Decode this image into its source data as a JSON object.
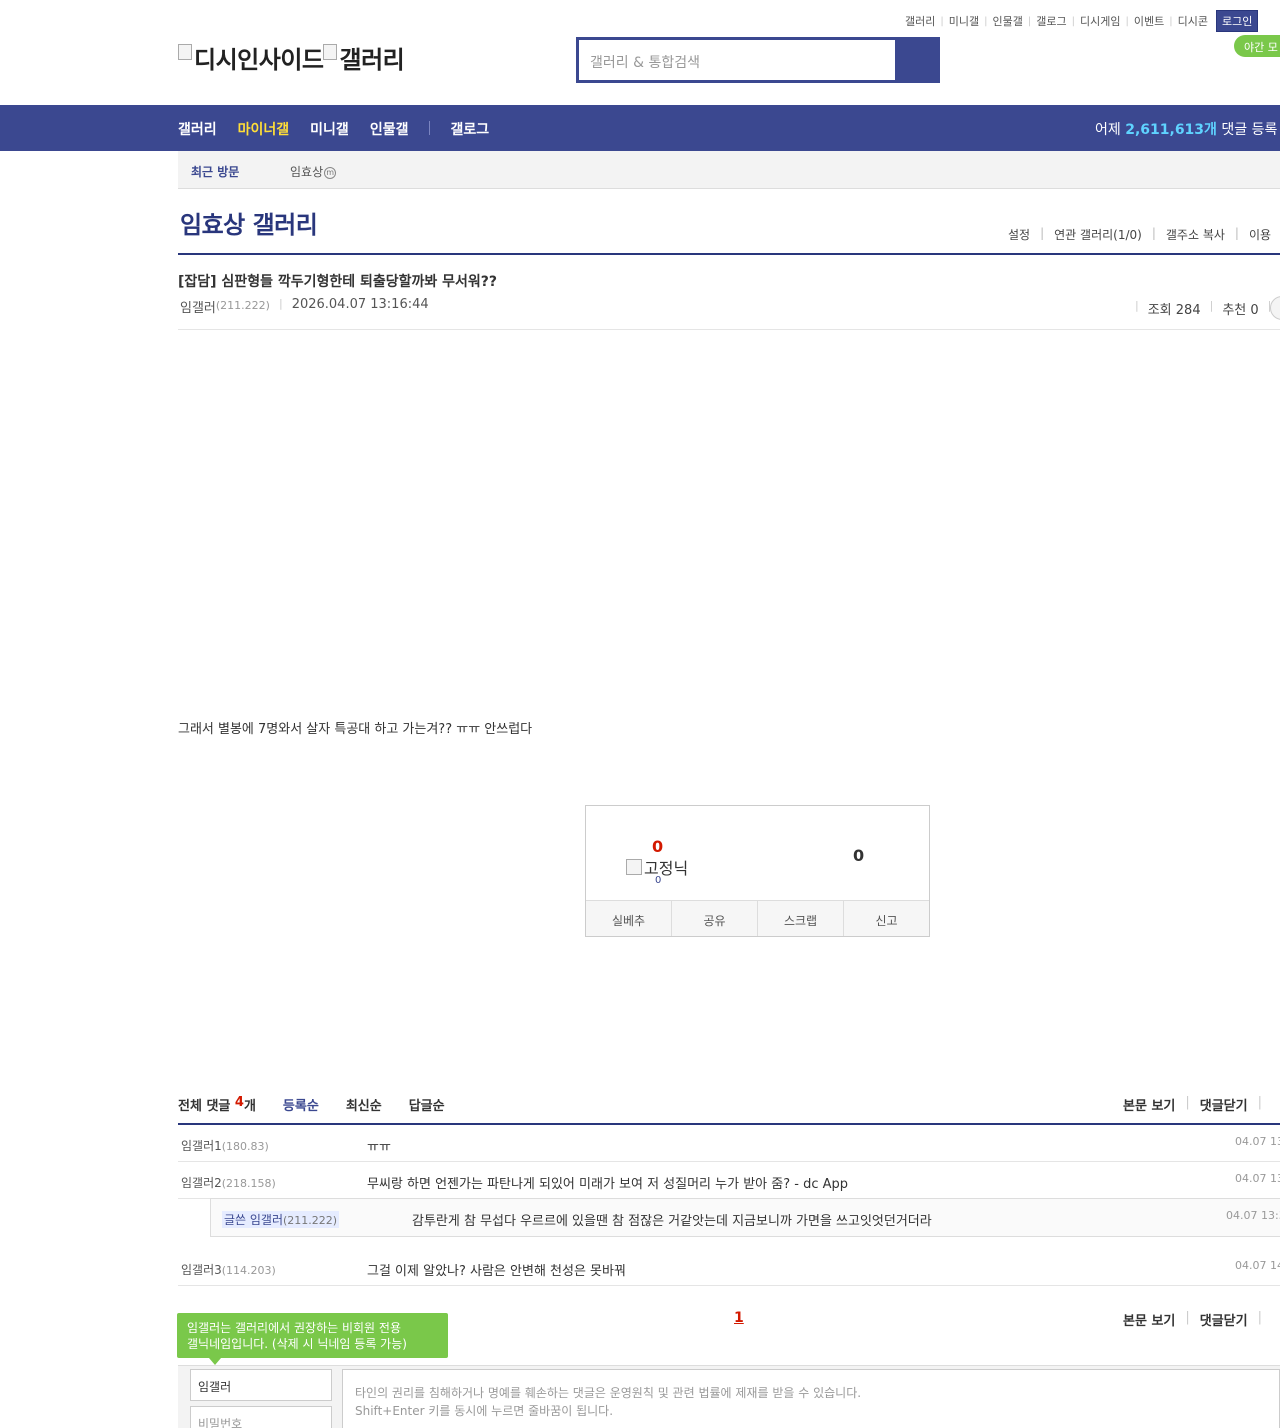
{
  "top_links": [
    "갤러리",
    "미니갤",
    "인물갤",
    "갤로그",
    "디시게임",
    "이벤트",
    "디시콘"
  ],
  "login_label": "로그인",
  "night_mode_label": "야간 모",
  "logo": {
    "left": "디시인사이드",
    "right": "갤러리"
  },
  "search": {
    "placeholder": "갤러리 & 통합검색"
  },
  "nav": {
    "items": [
      "갤러리",
      "마이너갤",
      "미니갤",
      "인물갤",
      "갤로그"
    ],
    "active": "마이너갤",
    "stat_prefix": "어제",
    "stat_value": "2,611,613개",
    "stat_suffix": "댓글 등록"
  },
  "recent": {
    "title": "최근 방문",
    "item": "임효상",
    "item_badge": "m"
  },
  "gallery": {
    "title": "임효상 갤러리",
    "menu": [
      "설정",
      "연관 갤러리(1/0)",
      "갤주소 복사",
      "이용"
    ]
  },
  "post": {
    "title": "[잡담] 심판형들 깍두기형한테 퇴출당할까봐 무서워??",
    "author": "임갤러",
    "author_ip": "(211.222)",
    "date": "2026.04.07 13:16:44",
    "views_label": "조회 284",
    "recommend_label": "추천 0",
    "body": "그래서 별봉에 7명와서 살자 특공대 하고 가는겨?? ㅠㅠ 안쓰럽다"
  },
  "recommend_box": {
    "up_count": "0",
    "fixnick_label": "고정닉",
    "fixnick_count": "0",
    "down_count": "0",
    "buttons": [
      "실베추",
      "공유",
      "스크랩",
      "신고"
    ]
  },
  "comments_header": {
    "total_prefix": "전체 댓글",
    "total_count": "4",
    "total_suffix": "개",
    "sorts": [
      "등록순",
      "최신순",
      "답글순"
    ],
    "right": [
      "본문 보기",
      "댓글닫기"
    ]
  },
  "comments": [
    {
      "nick": "임갤러1",
      "ip": "(180.83)",
      "text": "ㅠㅠ",
      "date": "04.07 13"
    },
    {
      "nick": "임갤러2",
      "ip": "(218.158)",
      "text": "무씨랑 하면 언젠가는 파탄나게 되있어 미래가 보여 저 성질머리 누가 받아 줌? - dc App",
      "date": "04.07 13"
    },
    {
      "nick": "임갤러3",
      "ip": "(114.203)",
      "text": "그걸 이제 알았나? 사람은 안변해 천성은 못바꿔",
      "date": "04.07 14"
    }
  ],
  "reply": {
    "nick": "글쓴 임갤러",
    "ip": "(211.222)",
    "text": "감투란게 참 무섭다 우르르에 있을땐 참 점잖은 거같앗는데 지금보니까 가면을 쓰고잇엇던거더라",
    "date": "04.07 13:3"
  },
  "pagination": {
    "current": "1"
  },
  "bottom_right": [
    "본문 보기",
    "댓글닫기"
  ],
  "tooltip": {
    "line1": "임갤러는 갤러리에서 권장하는 비회원 전용",
    "line2": "갤닉네임입니다. (삭제 시 닉네임 등록 가능)"
  },
  "write": {
    "nick_value": "임갤러",
    "password_placeholder": "비밀번호",
    "notice_line1": "타인의 권리를 침해하거나 명예를 훼손하는 댓글은 운영원칙 및 관련 법률에 제재를 받을 수 있습니다.",
    "notice_line2": "Shift+Enter 키를 동시에 누르면 줄바꿈이 됩니다."
  },
  "colors": {
    "brand": "#3b4890",
    "accent_yellow": "#ffde38",
    "accent_green": "#7ac84a",
    "alert_red": "#d31900"
  }
}
